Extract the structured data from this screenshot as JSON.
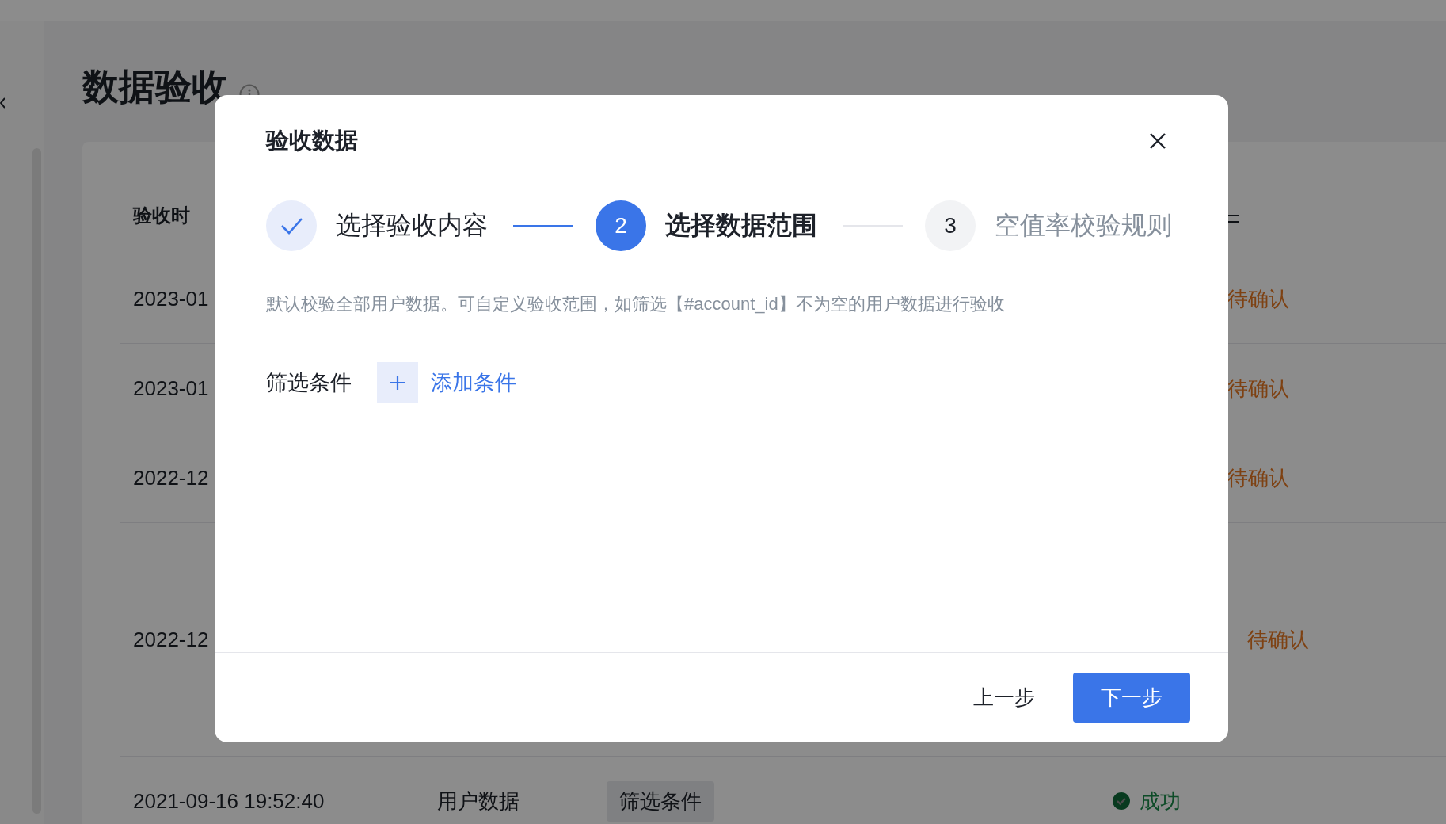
{
  "page": {
    "title": "数据验收"
  },
  "table": {
    "columns": [
      "验收时"
    ],
    "rows": [
      {
        "kind": "pending",
        "time": "2023-01",
        "status": "待确认"
      },
      {
        "kind": "pending",
        "time": "2023-01",
        "status": "待确认"
      },
      {
        "kind": "pending",
        "time": "2022-12",
        "status": "待确认"
      },
      {
        "kind": "pending",
        "time": "2022-12",
        "status": "待确认"
      },
      {
        "kind": "success",
        "time": "2021-09-16 19:52:40",
        "type": "用户数据",
        "scope": "筛选条件",
        "status": "成功"
      }
    ]
  },
  "dialog": {
    "title": "验收数据",
    "steps": [
      {
        "completed": true,
        "selected": false,
        "label": "选择验收内容"
      },
      {
        "completed": false,
        "selected": true,
        "number": "2",
        "label": "选择数据范围"
      },
      {
        "completed": false,
        "selected": false,
        "number": "3",
        "label": "空值率校验规则"
      }
    ],
    "description": "默认校验全部用户数据。可自定义验收范围，如筛选【#account_id】不为空的用户数据进行验收",
    "filter_label": "筛选条件",
    "add_label": "添加条件",
    "buttons": [
      {
        "kind": "secondary",
        "label": "上一步"
      },
      {
        "kind": "primary",
        "label": "下一步"
      }
    ]
  }
}
